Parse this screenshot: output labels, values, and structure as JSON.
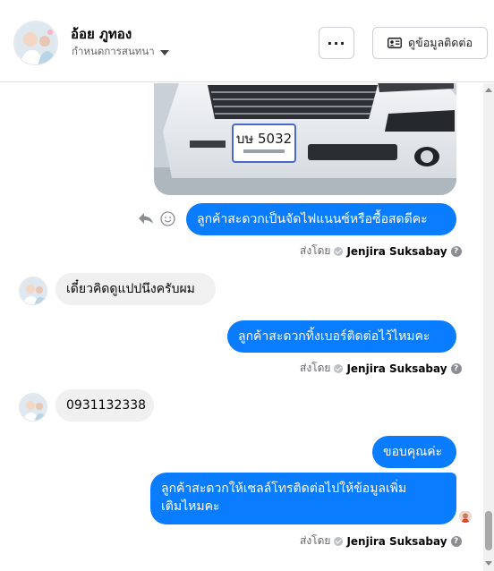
{
  "header": {
    "contact_name": "อ้อย ภูทอง",
    "subtitle": "กำหนดการสนทนา",
    "more_label": "···",
    "contact_info_label": "ดูข้อมูลติดต่อ"
  },
  "image_message": {
    "plate_text": "บษ 5032"
  },
  "messages": [
    {
      "direction": "out",
      "text": "ลูกค้าสะดวกเป็นจัดไฟแนนซ์หรือซื้อสดดีคะ"
    },
    {
      "direction": "in",
      "text": "เดี๋ยวคิดดูแปปนึงครับผม"
    },
    {
      "direction": "out",
      "text": "ลูกค้าสะดวกทิ้งเบอร์ติดต่อไว้ไหมคะ"
    },
    {
      "direction": "in",
      "text": "0931132338"
    },
    {
      "direction": "out",
      "text": "ขอบคุณค่ะ"
    },
    {
      "direction": "out",
      "text_line1": "ลูกค้าสะดวกให้เซลล์โทรติดต่อไปให้ข้อมูลเพิ่ม",
      "text_line2": "เติมไหมคะ"
    }
  ],
  "sent_by": {
    "prefix": "ส่งโดย",
    "agent_name": "Jenjira Suksabay"
  },
  "colors": {
    "outgoing_bubble": "#0a7cff",
    "incoming_bubble": "#f0f0f0"
  },
  "icons": [
    "reply-icon",
    "emoji-icon",
    "contact-card-icon",
    "more-icon",
    "check-icon",
    "help-icon"
  ]
}
